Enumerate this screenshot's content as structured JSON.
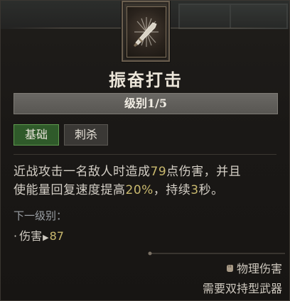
{
  "skill": {
    "name": "振奋打击",
    "level_label": "级别1/5",
    "tags": [
      "基础",
      "刺杀"
    ]
  },
  "description": {
    "line1_a": "近战攻击一名敌人时造成",
    "line1_num": "79",
    "line1_b": "点伤害，并且",
    "line2_a": "使能量回复速度提高",
    "line2_num": "20%",
    "line2_b": "，持续",
    "line2_num2": "3",
    "line2_c": "秒。"
  },
  "next_level": {
    "title": "下一级别：",
    "stat_label": "伤害",
    "stat_value": "87"
  },
  "footer": {
    "damage_type": "物理伤害",
    "requirement": "需要双持型武器"
  },
  "icons": {
    "skill": "crossed-blades-icon",
    "damage_type": "fist-icon"
  },
  "colors": {
    "highlight_number": "#c9b96e",
    "tag_basic_bg": "#2f5a2a",
    "tag_basic_border": "#5e9a4e"
  }
}
